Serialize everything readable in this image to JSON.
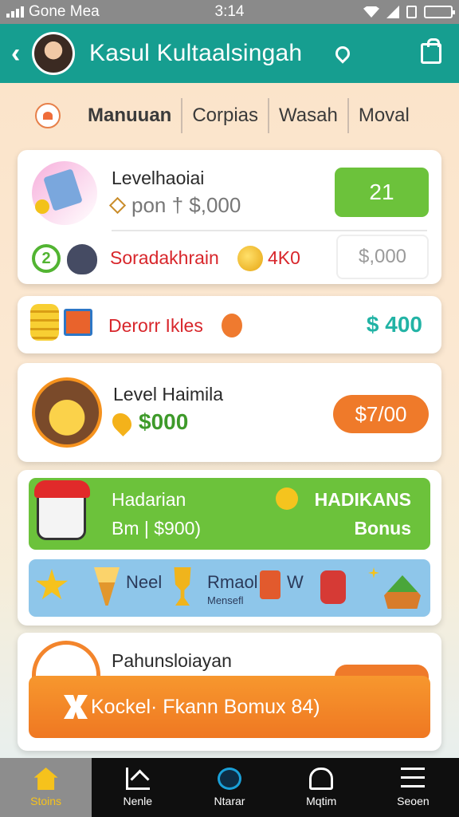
{
  "status_bar": {
    "carrier": "Gone Mea",
    "time": "3:14"
  },
  "app_bar": {
    "back_icon": "chevron-left-icon",
    "title": "Kasul Kultaalsingah"
  },
  "tabs": [
    "Manuuan",
    "Corpias",
    "Wasah",
    "Moval"
  ],
  "card_1": {
    "title": "Levelhaoiai",
    "tag": "pon † $,000",
    "button": "21",
    "promo_label": "Soradakhrain",
    "promo_value": "4K0",
    "amount": "$,000"
  },
  "card_2": {
    "label": "Derorr Ikles",
    "amount": "$ 400"
  },
  "card_3": {
    "title": "Level Haimila",
    "amount": "$000",
    "button": "$7/00"
  },
  "card_4": {
    "banner": {
      "line1": "Hadarian",
      "line2": "Bm | $900)",
      "right1": "HADIKANS",
      "right2": "Bonus"
    },
    "strip": {
      "t1": "Neel",
      "t2": "Rmaol",
      "t3": "Mensefl",
      "t4": "W"
    }
  },
  "card_5": {
    "title": "Pahunsloiayan",
    "cta": "Kockel· Fkann Bomux 84)"
  },
  "bottom_nav": [
    {
      "label": "Stoins",
      "icon": "home-icon",
      "active": true
    },
    {
      "label": "Nenle",
      "icon": "chart-icon",
      "active": false
    },
    {
      "label": "Ntarar",
      "icon": "compass-icon",
      "active": false
    },
    {
      "label": "Mqtim",
      "icon": "bell-icon",
      "active": false
    },
    {
      "label": "Seoen",
      "icon": "menu-icon",
      "active": false
    }
  ],
  "colors": {
    "app_bar": "#169e90",
    "green": "#6cc23b",
    "orange": "#ef7a2a",
    "teal": "#22b3a5",
    "red": "#d8262b"
  }
}
